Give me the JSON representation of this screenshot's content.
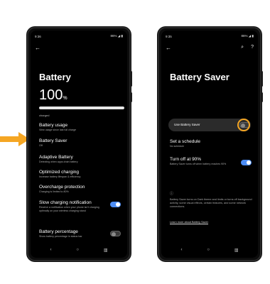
{
  "left_phone": {
    "status": {
      "time": "9:36",
      "right": "86% ◢ ▮"
    },
    "title": "Battery",
    "level": {
      "value": "100",
      "unit": "%",
      "fraction": 1.0
    },
    "charged_label": "charged",
    "items": [
      {
        "title": "Battery usage",
        "subtitle": "View usage since last full charge"
      },
      {
        "title": "Battery Saver",
        "subtitle": "Off"
      },
      {
        "title": "Adaptive Battery",
        "subtitle": "Detecting when apps drain battery"
      },
      {
        "title": "Optimized charging",
        "subtitle": "Increase battery lifespan & efficiency"
      },
      {
        "title": "Overcharge protection",
        "subtitle": "Charging is limited to 80%"
      },
      {
        "title": "Slow charging notification",
        "subtitle": "Receive a notification when your phone isn't charging optimally on your wireless charging stand"
      },
      {
        "title": "Battery percentage",
        "subtitle": "Show battery percentage in status bar"
      }
    ],
    "toggles": {
      "slow_charging": true,
      "battery_percentage": false
    }
  },
  "right_phone": {
    "status": {
      "time": "9:35",
      "right": "86% ◢ ▮"
    },
    "title": "Battery Saver",
    "use_label": "Use Battery Saver",
    "use_on": false,
    "schedule": {
      "title": "Set a schedule",
      "subtitle": "No schedule"
    },
    "turn_off": {
      "title": "Turn off at 90%",
      "subtitle": "Battery Saver turns off when battery reaches 90%",
      "on": true
    },
    "footnote": "Battery Saver turns on Dark theme and limits or turns off background activity, some visual effects, certain features, and some network connections.",
    "learn_more": "Learn more about Battery Saver"
  },
  "nav_icons": [
    "back-icon",
    "home-icon",
    "recents-icon"
  ],
  "colors": {
    "accent": "#4c8df6",
    "highlight": "#f5a623",
    "arrow": "#f5a623"
  }
}
